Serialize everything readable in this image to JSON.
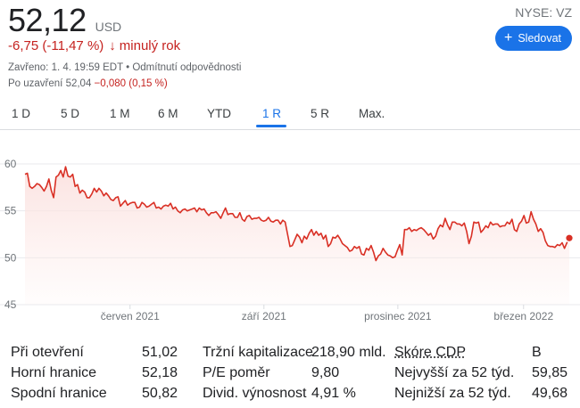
{
  "quote": {
    "price": "52,12",
    "currency": "USD",
    "change": "-6,75 (-11,47 %)",
    "change_arrow": "↓",
    "change_period": "minulý rok",
    "ticker": "NYSE: VZ",
    "follow_label": "Sledovat",
    "follow_icon": "plus-icon",
    "closed_text": "Zavřeno: 1. 4. 19:59 EDT • Odmítnutí odpovědnosti",
    "after_hours_label": "Po uzavření 52,04",
    "after_hours_change": "−0,080 (0,15 %)",
    "negative_color": "#c5221f",
    "accent_color": "#1a73e8"
  },
  "tabs": [
    {
      "label": "1 D",
      "active": false
    },
    {
      "label": "5 D",
      "active": false
    },
    {
      "label": "1 M",
      "active": false
    },
    {
      "label": "6 M",
      "active": false
    },
    {
      "label": "YTD",
      "active": false
    },
    {
      "label": "1 R",
      "active": true
    },
    {
      "label": "5 R",
      "active": false
    },
    {
      "label": "Max.",
      "active": false
    }
  ],
  "chart_data": {
    "type": "area",
    "title": "",
    "xlabel": "",
    "ylabel": "",
    "ylim": [
      45,
      60
    ],
    "yticks": [
      60,
      55,
      50,
      45
    ],
    "xticks": [
      {
        "label": "červen 2021",
        "x": 0.193
      },
      {
        "label": "září 2021",
        "x": 0.439
      },
      {
        "label": "prosinec 2021",
        "x": 0.685
      },
      {
        "label": "březen 2022",
        "x": 0.916
      }
    ],
    "grid": true,
    "line_color": "#d93025",
    "series": [
      {
        "values": [
          58.9,
          59.0,
          57.6,
          57.4,
          57.6,
          57.9,
          57.8,
          57.5,
          57.1,
          57.6,
          58.4,
          57.2,
          56.4,
          58.6,
          58.8,
          59.3,
          58.6,
          59.7,
          58.7,
          58.6,
          58.9,
          57.6,
          57.8,
          56.9,
          57.2,
          57.0,
          56.4,
          56.4,
          56.8,
          57.4,
          57.0,
          57.4,
          57.1,
          56.6,
          56.9,
          56.6,
          56.2,
          56.1,
          56.4,
          56.5,
          55.5,
          55.8,
          56.1,
          55.6,
          55.8,
          55.9,
          55.9,
          55.3,
          55.4,
          55.9,
          55.7,
          55.4,
          55.5,
          55.7,
          55.9,
          55.3,
          55.4,
          55.2,
          55.5,
          55.6,
          55.5,
          55.8,
          55.2,
          55.4,
          55.0,
          54.8,
          55.1,
          55.2,
          55.0,
          55.1,
          55.2,
          55.3,
          54.9,
          55.3,
          55.1,
          55.2,
          54.8,
          54.5,
          54.8,
          54.8,
          54.9,
          54.6,
          54.2,
          54.8,
          55.3,
          54.6,
          54.7,
          54.7,
          54.3,
          54.3,
          54.8,
          54.1,
          53.9,
          54.4,
          54.5,
          54.1,
          54.2,
          54.2,
          54.3,
          54.0,
          53.9,
          54.0,
          54.3,
          53.9,
          53.8,
          54.0,
          54.0,
          53.6,
          54.0,
          53.8,
          52.5,
          51.2,
          51.3,
          51.9,
          52.5,
          52.2,
          51.6,
          52.3,
          52.0,
          52.6,
          53.0,
          52.4,
          52.8,
          52.4,
          52.6,
          52.0,
          52.4,
          51.2,
          51.5,
          52.2,
          52.1,
          52.4,
          52.0,
          51.5,
          51.3,
          51.1,
          50.7,
          50.8,
          51.2,
          51.0,
          51.2,
          50.4,
          50.3,
          51.0,
          50.8,
          51.3,
          50.6,
          49.7,
          50.2,
          50.4,
          51.0,
          50.6,
          50.3,
          50.2,
          50.0,
          50.1,
          50.8,
          51.4,
          50.3,
          53.0,
          53.0,
          53.2,
          52.8,
          53.0,
          52.9,
          53.1,
          53.2,
          53.0,
          52.7,
          52.4,
          52.6,
          52.0,
          52.3,
          53.1,
          53.5,
          53.3,
          54.2,
          53.5,
          53.0,
          53.8,
          53.8,
          53.6,
          53.6,
          53.4,
          53.7,
          52.8,
          51.5,
          52.3,
          53.8,
          53.7,
          53.8,
          52.7,
          53.0,
          53.4,
          53.2,
          53.8,
          53.5,
          53.6,
          53.6,
          53.3,
          53.4,
          53.4,
          53.8,
          53.6,
          54.1,
          53.0,
          52.8,
          53.6,
          53.9,
          54.5,
          53.7,
          53.8,
          54.9,
          54.1,
          53.6,
          52.8,
          53.1,
          52.7,
          51.8,
          51.3,
          51.2,
          51.2,
          51.1,
          51.4,
          51.3,
          51.6,
          51.0,
          51.6,
          52.1
        ]
      }
    ],
    "end_marker": true
  },
  "stats": {
    "col1": [
      {
        "label": "Při otevření",
        "value": "51,02"
      },
      {
        "label": "Horní hranice",
        "value": "52,18"
      },
      {
        "label": "Spodní hranice",
        "value": "50,82"
      }
    ],
    "col2": [
      {
        "label": "Tržní kapitalizace",
        "value": "218,90 mld."
      },
      {
        "label": "P/E poměr",
        "value": "9,80"
      },
      {
        "label": "Divid. výnosnost",
        "value": "4,91 %"
      }
    ],
    "col3": [
      {
        "label": "Skóre CDP",
        "value": "B"
      },
      {
        "label": "Nejvyšší za 52 týd.",
        "value": "59,85"
      },
      {
        "label": "Nejnižší za 52 týd.",
        "value": "49,68"
      }
    ]
  }
}
